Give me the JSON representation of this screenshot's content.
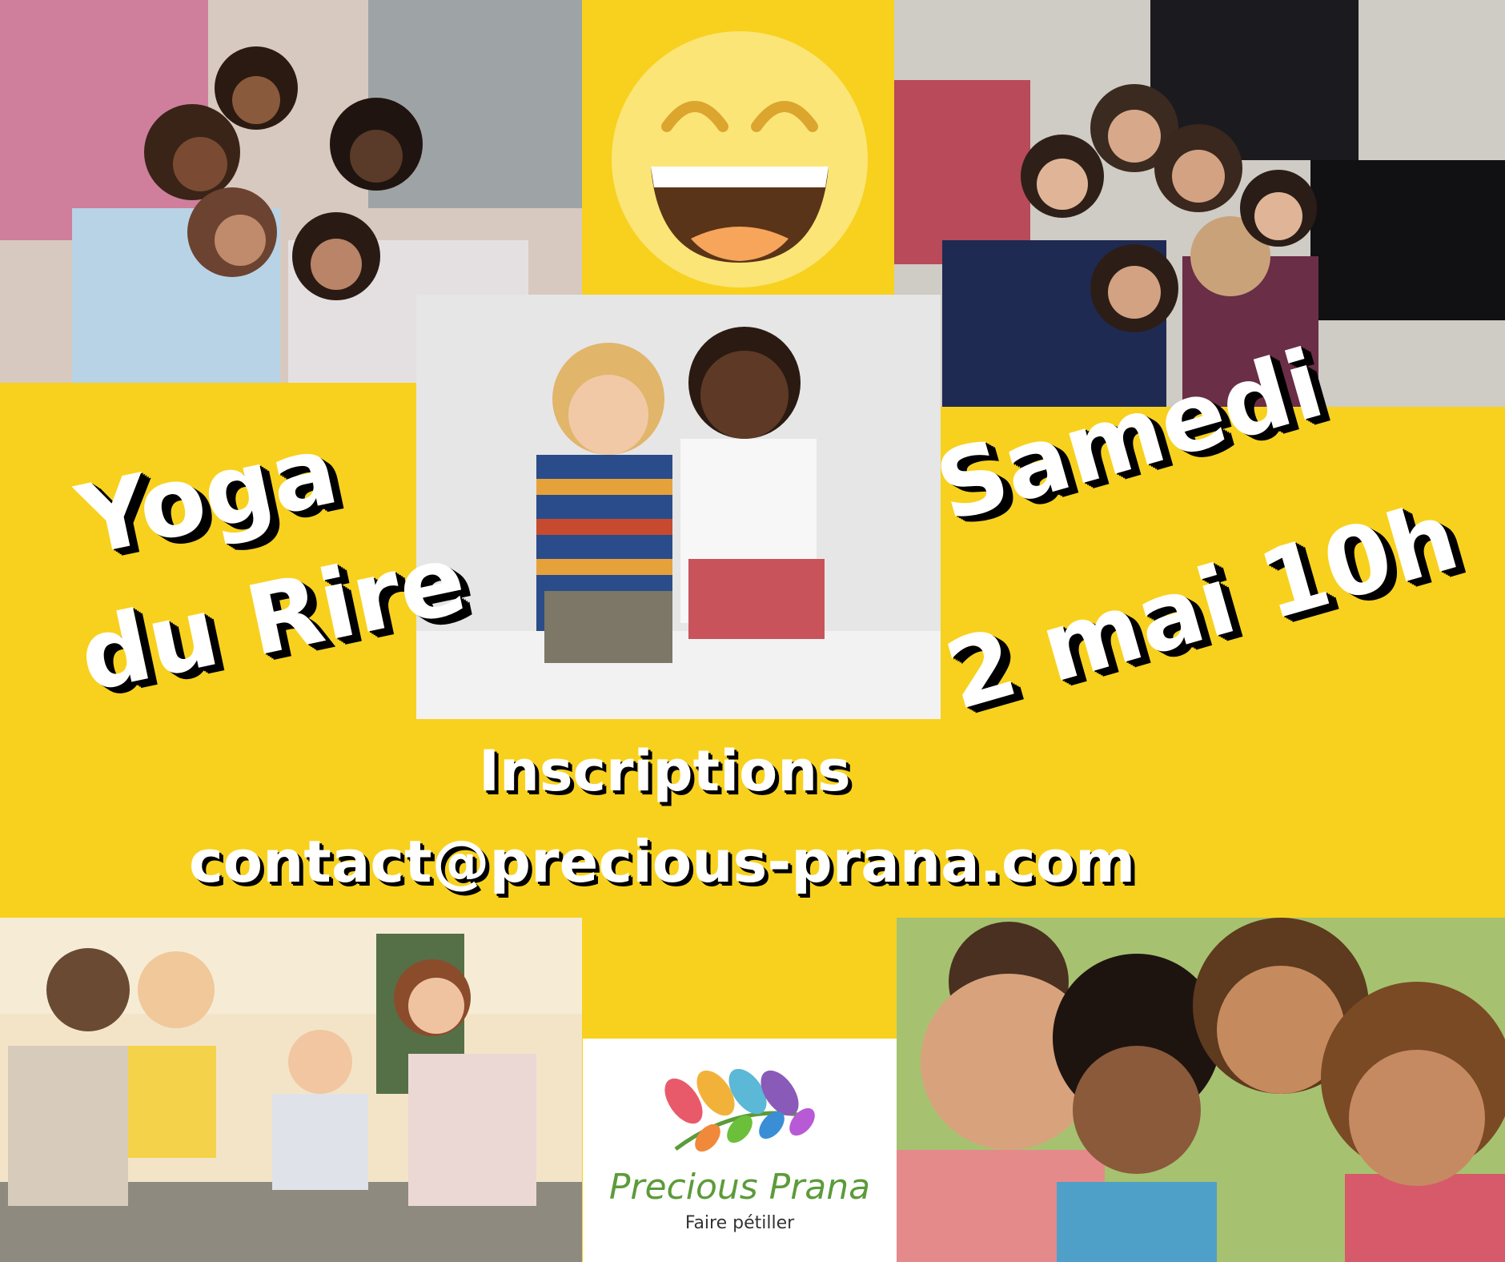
{
  "headline": {
    "title_line1": "Yoga",
    "title_line2": "du Rire",
    "day": "Samedi",
    "date": "2 mai 10h"
  },
  "registration": {
    "label": "Inscriptions",
    "email": "contact@precious-prana.com"
  },
  "logo": {
    "name": "Precious Prana",
    "tagline": "Faire pétiller"
  },
  "colors": {
    "background": "#f7d11e",
    "headline_text": "#ffffff",
    "headline_shadow": "#000000",
    "logo_green": "#5c9b3a"
  },
  "icons": [
    "laughing-emoji-icon",
    "leaves-logo-icon"
  ]
}
